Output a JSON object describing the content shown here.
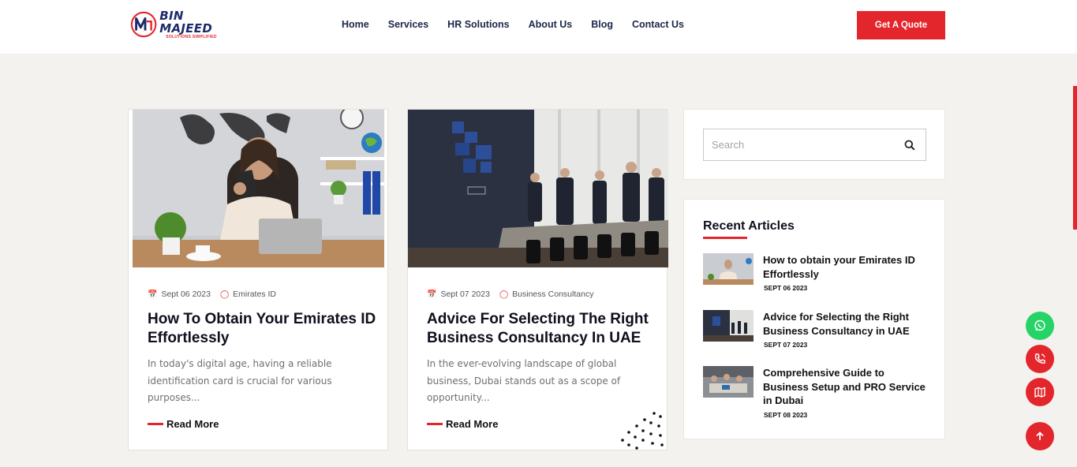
{
  "header": {
    "logo": {
      "name": "BIN MAJEED",
      "tagline": "SOLUTIONS SIMPLIFIED"
    },
    "nav": [
      "Home",
      "Services",
      "HR Solutions",
      "About Us",
      "Blog",
      "Contact Us"
    ],
    "cta_label": "Get A Quote"
  },
  "posts": [
    {
      "date": "Sept 06 2023",
      "category": "Emirates ID",
      "title": "How To Obtain Your Emirates ID Effortlessly",
      "excerpt": "In today's digital age, having a reliable identification card is crucial for various purposes...",
      "read_more": "Read More"
    },
    {
      "date": "Sept 07 2023",
      "category": "Business Consultancy",
      "title": "Advice For Selecting The Right Business Consultancy In UAE",
      "excerpt": "In the ever-evolving landscape of global business, Dubai stands out as a scope of opportunity...",
      "read_more": "Read More"
    }
  ],
  "sidebar": {
    "search": {
      "placeholder": "Search"
    },
    "recent": {
      "heading": "Recent Articles",
      "items": [
        {
          "title": "How to obtain your Emirates ID Effortlessly",
          "date": "SEPT 06 2023"
        },
        {
          "title": "Advice for Selecting the Right Business Consultancy in UAE",
          "date": "SEPT 07 2023"
        },
        {
          "title": "Comprehensive Guide to Business Setup and PRO Service in Dubai",
          "date": "SEPT 08 2023"
        }
      ]
    }
  },
  "floating": {
    "whatsapp_icon": "whatsapp-icon",
    "call_icon": "phone-call-icon",
    "map_icon": "map-icon",
    "top_icon": "arrow-up-icon"
  },
  "colors": {
    "accent": "#e3262c",
    "whatsapp": "#25d366",
    "brand_navy": "#1c2b6b"
  }
}
